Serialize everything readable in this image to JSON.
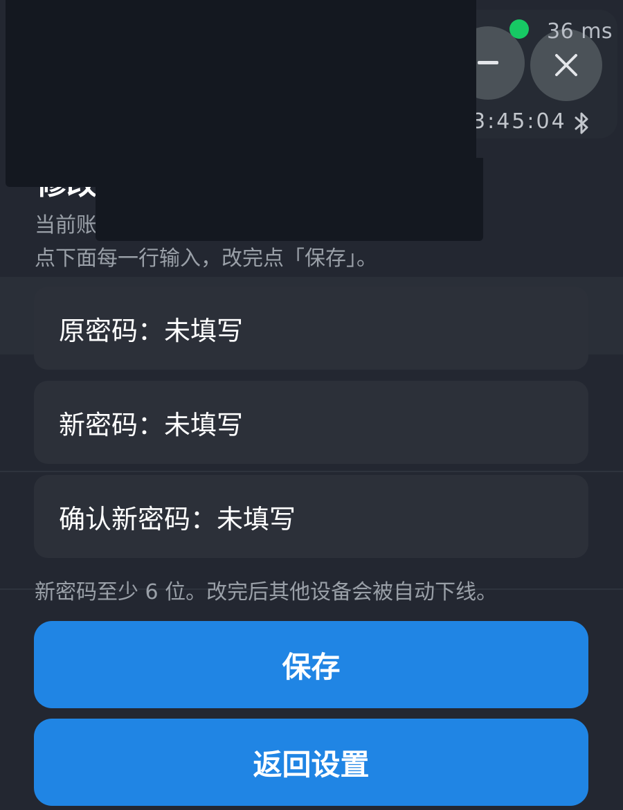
{
  "status": {
    "latency_text": "36 ms",
    "clock_text": "3:45:04",
    "connected_color": "#17c964"
  },
  "dialog": {
    "title": "修改",
    "subtitle": "当前账",
    "instruction": "点下面每一行输入，改完点「保存」。",
    "fields": [
      {
        "label": "原密码：未填写"
      },
      {
        "label": "新密码：未填写"
      },
      {
        "label": "确认新密码：未填写"
      }
    ],
    "hint": "新密码至少 6 位。改完后其他设备会被自动下线。",
    "save_label": "保存",
    "back_label": "返回设置"
  },
  "icons": {
    "minimize": "minimize-icon",
    "close": "close-icon",
    "bluetooth": "bluetooth-icon"
  },
  "colors": {
    "accent": "#2085e4",
    "background": "#232731",
    "field_bg": "#2c3039"
  }
}
